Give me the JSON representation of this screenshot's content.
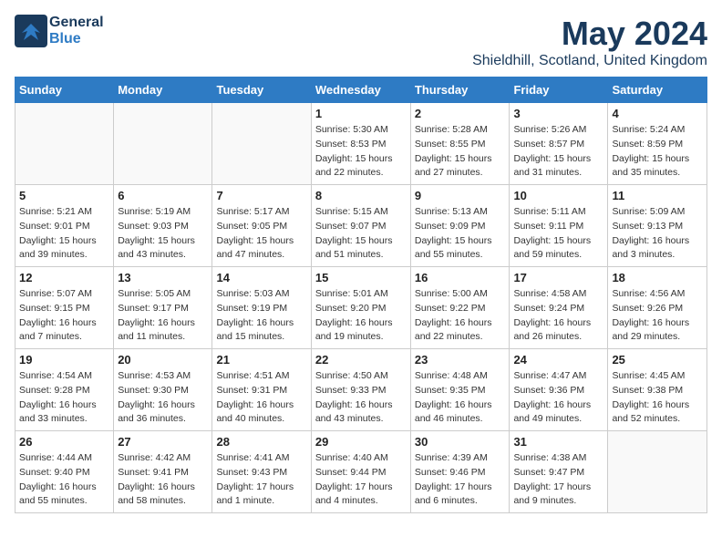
{
  "header": {
    "logo_general": "General",
    "logo_blue": "Blue",
    "title": "May 2024",
    "location": "Shieldhill, Scotland, United Kingdom"
  },
  "days_of_week": [
    "Sunday",
    "Monday",
    "Tuesday",
    "Wednesday",
    "Thursday",
    "Friday",
    "Saturday"
  ],
  "weeks": [
    [
      {
        "day": "",
        "info": ""
      },
      {
        "day": "",
        "info": ""
      },
      {
        "day": "",
        "info": ""
      },
      {
        "day": "1",
        "info": "Sunrise: 5:30 AM\nSunset: 8:53 PM\nDaylight: 15 hours\nand 22 minutes."
      },
      {
        "day": "2",
        "info": "Sunrise: 5:28 AM\nSunset: 8:55 PM\nDaylight: 15 hours\nand 27 minutes."
      },
      {
        "day": "3",
        "info": "Sunrise: 5:26 AM\nSunset: 8:57 PM\nDaylight: 15 hours\nand 31 minutes."
      },
      {
        "day": "4",
        "info": "Sunrise: 5:24 AM\nSunset: 8:59 PM\nDaylight: 15 hours\nand 35 minutes."
      }
    ],
    [
      {
        "day": "5",
        "info": "Sunrise: 5:21 AM\nSunset: 9:01 PM\nDaylight: 15 hours\nand 39 minutes."
      },
      {
        "day": "6",
        "info": "Sunrise: 5:19 AM\nSunset: 9:03 PM\nDaylight: 15 hours\nand 43 minutes."
      },
      {
        "day": "7",
        "info": "Sunrise: 5:17 AM\nSunset: 9:05 PM\nDaylight: 15 hours\nand 47 minutes."
      },
      {
        "day": "8",
        "info": "Sunrise: 5:15 AM\nSunset: 9:07 PM\nDaylight: 15 hours\nand 51 minutes."
      },
      {
        "day": "9",
        "info": "Sunrise: 5:13 AM\nSunset: 9:09 PM\nDaylight: 15 hours\nand 55 minutes."
      },
      {
        "day": "10",
        "info": "Sunrise: 5:11 AM\nSunset: 9:11 PM\nDaylight: 15 hours\nand 59 minutes."
      },
      {
        "day": "11",
        "info": "Sunrise: 5:09 AM\nSunset: 9:13 PM\nDaylight: 16 hours\nand 3 minutes."
      }
    ],
    [
      {
        "day": "12",
        "info": "Sunrise: 5:07 AM\nSunset: 9:15 PM\nDaylight: 16 hours\nand 7 minutes."
      },
      {
        "day": "13",
        "info": "Sunrise: 5:05 AM\nSunset: 9:17 PM\nDaylight: 16 hours\nand 11 minutes."
      },
      {
        "day": "14",
        "info": "Sunrise: 5:03 AM\nSunset: 9:19 PM\nDaylight: 16 hours\nand 15 minutes."
      },
      {
        "day": "15",
        "info": "Sunrise: 5:01 AM\nSunset: 9:20 PM\nDaylight: 16 hours\nand 19 minutes."
      },
      {
        "day": "16",
        "info": "Sunrise: 5:00 AM\nSunset: 9:22 PM\nDaylight: 16 hours\nand 22 minutes."
      },
      {
        "day": "17",
        "info": "Sunrise: 4:58 AM\nSunset: 9:24 PM\nDaylight: 16 hours\nand 26 minutes."
      },
      {
        "day": "18",
        "info": "Sunrise: 4:56 AM\nSunset: 9:26 PM\nDaylight: 16 hours\nand 29 minutes."
      }
    ],
    [
      {
        "day": "19",
        "info": "Sunrise: 4:54 AM\nSunset: 9:28 PM\nDaylight: 16 hours\nand 33 minutes."
      },
      {
        "day": "20",
        "info": "Sunrise: 4:53 AM\nSunset: 9:30 PM\nDaylight: 16 hours\nand 36 minutes."
      },
      {
        "day": "21",
        "info": "Sunrise: 4:51 AM\nSunset: 9:31 PM\nDaylight: 16 hours\nand 40 minutes."
      },
      {
        "day": "22",
        "info": "Sunrise: 4:50 AM\nSunset: 9:33 PM\nDaylight: 16 hours\nand 43 minutes."
      },
      {
        "day": "23",
        "info": "Sunrise: 4:48 AM\nSunset: 9:35 PM\nDaylight: 16 hours\nand 46 minutes."
      },
      {
        "day": "24",
        "info": "Sunrise: 4:47 AM\nSunset: 9:36 PM\nDaylight: 16 hours\nand 49 minutes."
      },
      {
        "day": "25",
        "info": "Sunrise: 4:45 AM\nSunset: 9:38 PM\nDaylight: 16 hours\nand 52 minutes."
      }
    ],
    [
      {
        "day": "26",
        "info": "Sunrise: 4:44 AM\nSunset: 9:40 PM\nDaylight: 16 hours\nand 55 minutes."
      },
      {
        "day": "27",
        "info": "Sunrise: 4:42 AM\nSunset: 9:41 PM\nDaylight: 16 hours\nand 58 minutes."
      },
      {
        "day": "28",
        "info": "Sunrise: 4:41 AM\nSunset: 9:43 PM\nDaylight: 17 hours\nand 1 minute."
      },
      {
        "day": "29",
        "info": "Sunrise: 4:40 AM\nSunset: 9:44 PM\nDaylight: 17 hours\nand 4 minutes."
      },
      {
        "day": "30",
        "info": "Sunrise: 4:39 AM\nSunset: 9:46 PM\nDaylight: 17 hours\nand 6 minutes."
      },
      {
        "day": "31",
        "info": "Sunrise: 4:38 AM\nSunset: 9:47 PM\nDaylight: 17 hours\nand 9 minutes."
      },
      {
        "day": "",
        "info": ""
      }
    ]
  ]
}
